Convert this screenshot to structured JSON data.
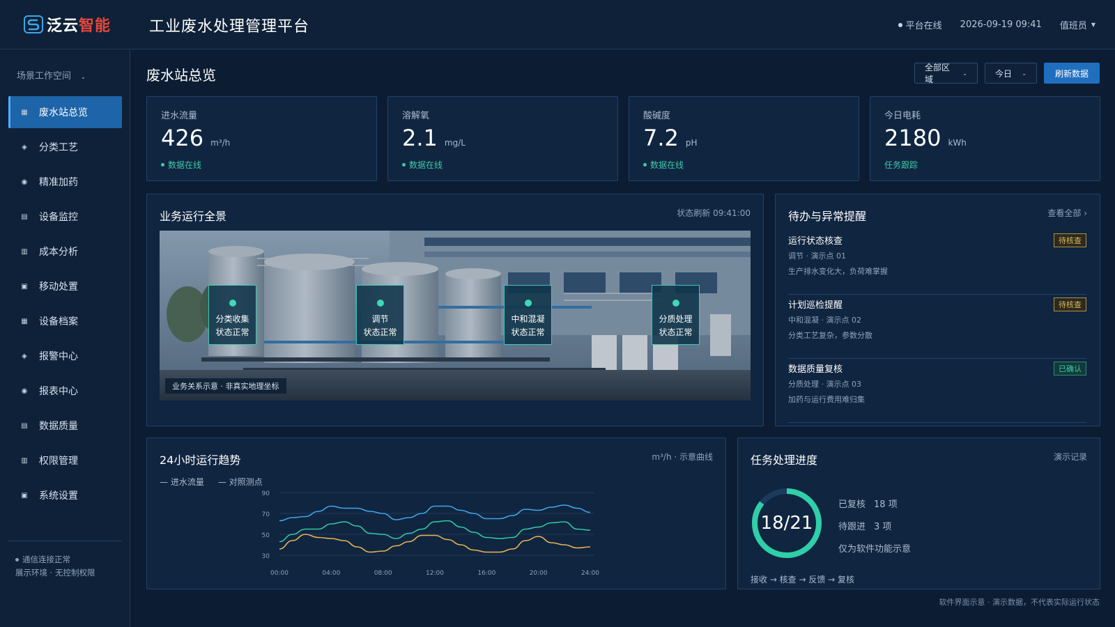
{
  "header": {
    "brand_prefix": "泛云",
    "brand_suffix": "智能",
    "platform_title": "工业废水处理管理平台",
    "status": "平台在线",
    "datetime": "2026-09-19 09:41",
    "user": "值班员"
  },
  "sidebar": {
    "workspace": "场景工作空间",
    "items": [
      {
        "label": "废水站总览",
        "icon": "grid-icon"
      },
      {
        "label": "分类工艺",
        "icon": "diamond-icon"
      },
      {
        "label": "精准加药",
        "icon": "target-icon"
      },
      {
        "label": "设备监控",
        "icon": "list-icon"
      },
      {
        "label": "成本分析",
        "icon": "bars-icon"
      },
      {
        "label": "移动处置",
        "icon": "square-icon"
      },
      {
        "label": "设备档案",
        "icon": "grid-icon"
      },
      {
        "label": "报警中心",
        "icon": "diamond-icon"
      },
      {
        "label": "报表中心",
        "icon": "target-icon"
      },
      {
        "label": "数据质量",
        "icon": "list-icon"
      },
      {
        "label": "权限管理",
        "icon": "bars-icon"
      },
      {
        "label": "系统设置",
        "icon": "square-icon"
      }
    ],
    "footer_status": "通信连接正常",
    "footer_note": "展示环境 · 无控制权限"
  },
  "main": {
    "title": "废水站总览",
    "filter_area": "全部区域",
    "filter_time": "今日",
    "refresh_label": "刷新数据"
  },
  "stats": [
    {
      "label": "进水流量",
      "value": "426",
      "unit": "m³/h",
      "status": "数据在线",
      "status_dot": true
    },
    {
      "label": "溶解氧",
      "value": "2.1",
      "unit": "mg/L",
      "status": "数据在线",
      "status_dot": true
    },
    {
      "label": "酸碱度",
      "value": "7.2",
      "unit": "pH",
      "status": "数据在线",
      "status_dot": true
    },
    {
      "label": "今日电耗",
      "value": "2180",
      "unit": "kWh",
      "status": "任务跟踪",
      "status_dot": false
    }
  ],
  "overview": {
    "title": "业务运行全景",
    "refresh_time": "状态刷新 09:41:00",
    "hotspots": [
      {
        "name": "分类收集",
        "state": "状态正常"
      },
      {
        "name": "调节",
        "state": "状态正常"
      },
      {
        "name": "中和混凝",
        "state": "状态正常"
      },
      {
        "name": "分质处理",
        "state": "状态正常"
      }
    ],
    "note": "业务关系示意 · 非真实地理坐标"
  },
  "alerts": {
    "title": "待办与异常提醒",
    "view_all": "查看全部 ›",
    "items": [
      {
        "title": "运行状态核查",
        "sub": "调节 · 演示点 01",
        "desc": "生产排水变化大，负荷难掌握",
        "badge": "待核查",
        "type": "warn"
      },
      {
        "title": "计划巡检提醒",
        "sub": "中和混凝 · 演示点 02",
        "desc": "分类工艺复杂，参数分散",
        "badge": "待核查",
        "type": "warn"
      },
      {
        "title": "数据质量复核",
        "sub": "分质处理 · 演示点 03",
        "desc": "加药与运行费用难归集",
        "badge": "已确认",
        "type": "ok"
      }
    ]
  },
  "trend": {
    "title": "24小时运行趋势",
    "meta": "m³/h · 示意曲线",
    "legend": [
      "— 进水流量",
      "— 对照测点"
    ]
  },
  "chart_data": {
    "type": "line",
    "x": [
      "00:00",
      "01:00",
      "02:00",
      "03:00",
      "04:00",
      "05:00",
      "06:00",
      "07:00",
      "08:00",
      "09:00",
      "10:00",
      "11:00",
      "12:00",
      "13:00",
      "14:00",
      "15:00",
      "16:00",
      "17:00",
      "18:00",
      "19:00",
      "20:00",
      "21:00",
      "22:00",
      "23:00",
      "24:00"
    ],
    "x_ticks": [
      "00:00",
      "04:00",
      "08:00",
      "12:00",
      "16:00",
      "20:00",
      "24:00"
    ],
    "ylim": [
      30,
      90
    ],
    "yticks": [
      30,
      50,
      70,
      90
    ],
    "grid": true,
    "series": [
      {
        "name": "进水流量",
        "color": "#3fa6e8",
        "values": [
          63,
          66,
          67,
          72,
          77,
          75,
          75,
          72,
          70,
          64,
          66,
          70,
          77,
          77,
          73,
          70,
          65,
          65,
          68,
          74,
          73,
          76,
          78,
          75,
          71
        ]
      },
      {
        "name": "对照测点",
        "color": "#35c9a1",
        "values": [
          43,
          50,
          55,
          55,
          60,
          62,
          58,
          51,
          50,
          46,
          51,
          55,
          62,
          63,
          57,
          52,
          47,
          46,
          47,
          55,
          57,
          61,
          62,
          55,
          54
        ]
      },
      {
        "name": "",
        "color": "#e5b555",
        "values": [
          36,
          44,
          50,
          47,
          46,
          44,
          38,
          33,
          34,
          39,
          43,
          49,
          49,
          45,
          40,
          35,
          33,
          33,
          36,
          44,
          48,
          42,
          40,
          37,
          38
        ]
      }
    ]
  },
  "progress": {
    "title": "任务处理进度",
    "meta": "演示记录",
    "done": 18,
    "total": 21,
    "ring_label": "18/21",
    "reviewed_label": "已复核",
    "reviewed_value": "18 项",
    "pending_label": "待跟进",
    "pending_value": "3 项",
    "note": "仅为软件功能示意",
    "flow": "接收 → 核查 → 反馈 → 复核",
    "ring_color": "#2fd0a8",
    "ring_track": "#1c3a5c"
  },
  "footnote": "软件界面示意 · 演示数据，不代表实际运行状态"
}
